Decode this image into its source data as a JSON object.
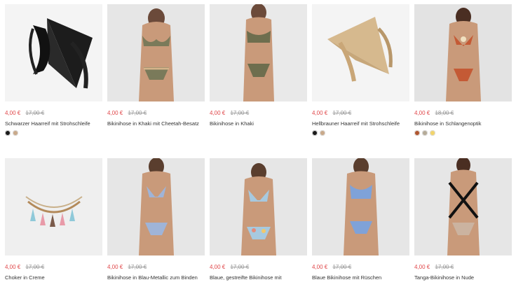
{
  "products": [
    {
      "price": "4,00 €",
      "old_price": "17,00 €",
      "name": "Schwarzer Haarreif mit Strohschleife",
      "swatches": [
        "#1a1a1a",
        "#c9a98a"
      ]
    },
    {
      "price": "4,00 €",
      "old_price": "17,00 €",
      "name": "Bikinihose in Khaki mit Cheetah-Besatz",
      "swatches": []
    },
    {
      "price": "4,00 €",
      "old_price": "17,00 €",
      "name": "Bikinihose in Khaki",
      "swatches": []
    },
    {
      "price": "4,00 €",
      "old_price": "17,00 €",
      "name": "Hellbrauner Haarreif mit Strohschleife",
      "swatches": [
        "#1a1a1a",
        "#c9a98a"
      ]
    },
    {
      "price": "4,00 €",
      "old_price": "18,00 €",
      "name": "Bikinihose in Schlangenoptik",
      "swatches": [
        "#b0562f",
        "#b5ab98",
        "#f2d46b"
      ]
    },
    {
      "price": "4,00 €",
      "old_price": "17,00 €",
      "name": "Choker in Creme",
      "swatches": []
    },
    {
      "price": "4,00 €",
      "old_price": "17,00 €",
      "name": "Bikinihose in Blau-Metallic zum Binden",
      "swatches": []
    },
    {
      "price": "4,00 €",
      "old_price": "17,00 €",
      "name": "Blaue, gestreifte Bikinihose mit",
      "swatches": []
    },
    {
      "price": "4,00 €",
      "old_price": "17,00 €",
      "name": "Blaue Bikinihose mit Rüschen",
      "swatches": []
    },
    {
      "price": "4,00 €",
      "old_price": "17,00 €",
      "name": "Tanga-Bikinihose in Nude",
      "swatches": []
    }
  ],
  "colors": {
    "sale": "#e0484b",
    "old": "#999999",
    "thumb_bg": "#ededed"
  }
}
